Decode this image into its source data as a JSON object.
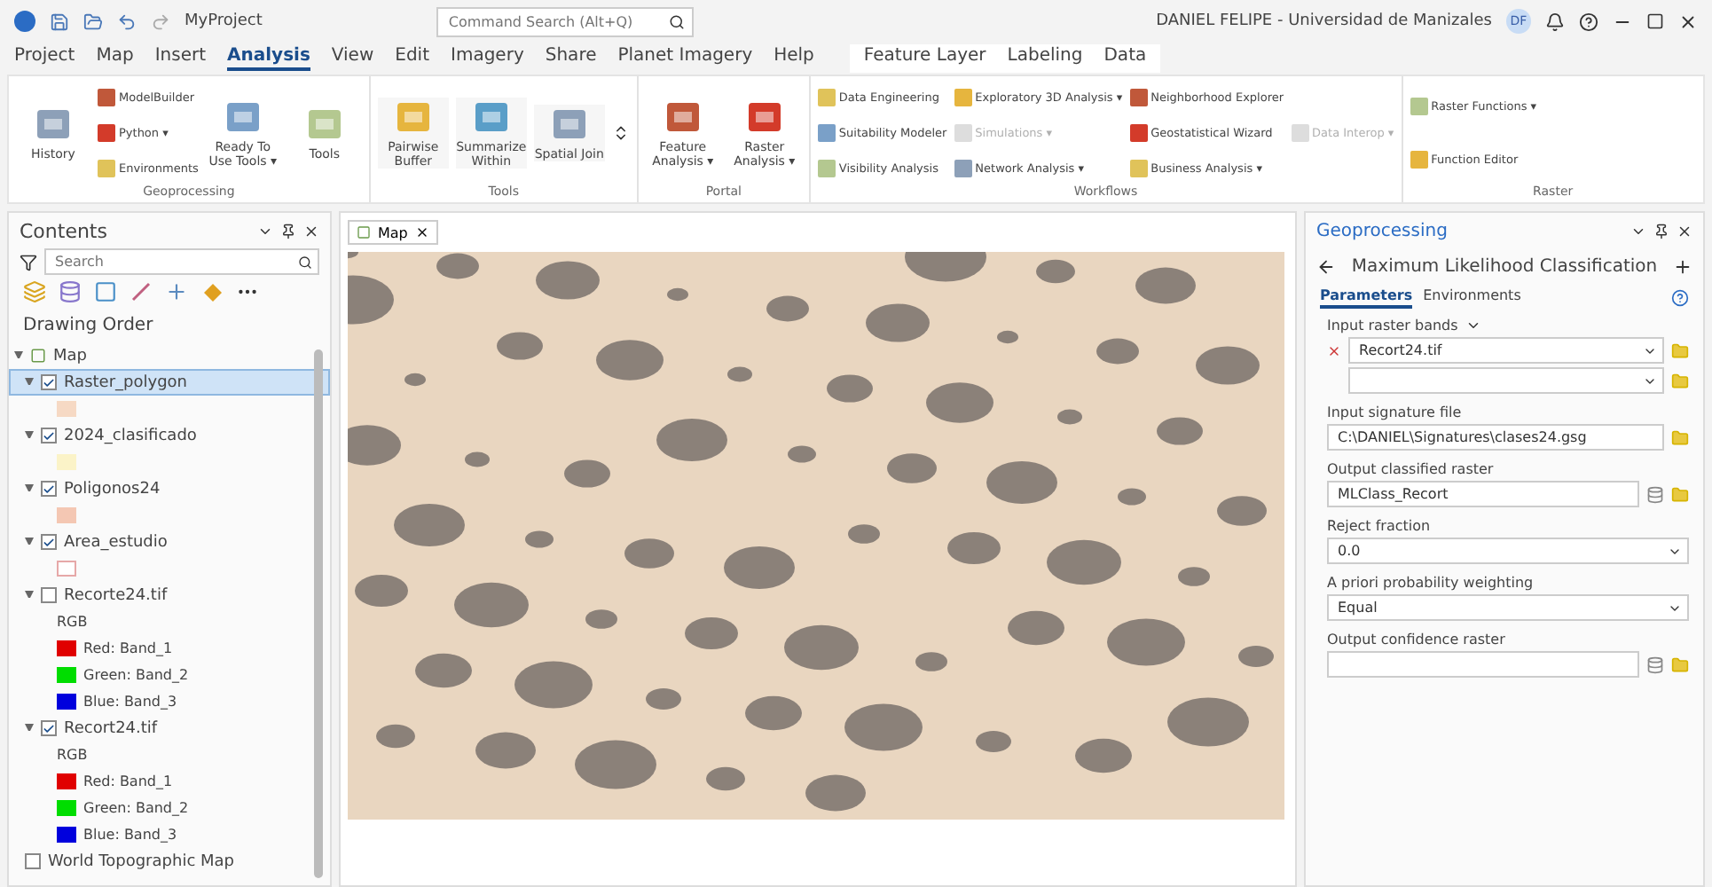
{
  "title_bar": {
    "project": "MyProject",
    "search_placeholder": "Command Search (Alt+Q)",
    "user": "DANIEL FELIPE - Universidad de Manizales",
    "initials": "DF"
  },
  "tabs": [
    {
      "label": "Project",
      "selected": false
    },
    {
      "label": "Map",
      "selected": false
    },
    {
      "label": "Insert",
      "selected": false
    },
    {
      "label": "Analysis",
      "selected": true
    },
    {
      "label": "View",
      "selected": false
    },
    {
      "label": "Edit",
      "selected": false
    },
    {
      "label": "Imagery",
      "selected": false
    },
    {
      "label": "Share",
      "selected": false
    },
    {
      "label": "Planet Imagery",
      "selected": false
    },
    {
      "label": "Help",
      "selected": false
    }
  ],
  "contextual_tabs": [
    {
      "label": "Feature Layer",
      "selected": false
    },
    {
      "label": "Labeling",
      "selected": false
    },
    {
      "label": "Data",
      "selected": false
    }
  ],
  "ribbon": [
    {
      "title": "Geoprocessing",
      "columns": [
        [
          {
            "label": "History",
            "kind": "large"
          }
        ],
        [
          {
            "label": "ModelBuilder",
            "kind": "small"
          },
          {
            "label": "Python ▾",
            "kind": "small"
          },
          {
            "label": "Environments",
            "kind": "small"
          }
        ],
        [
          {
            "label": "Ready To Use Tools ▾",
            "kind": "large"
          }
        ],
        [
          {
            "label": "Tools",
            "kind": "large"
          }
        ]
      ]
    },
    {
      "title": "Tools",
      "columns": [
        [
          {
            "label": "Pairwise Buffer",
            "kind": "gallery"
          }
        ],
        [
          {
            "label": "Summarize Within",
            "kind": "gallery"
          }
        ],
        [
          {
            "label": "Spatial Join",
            "kind": "gallery"
          }
        ]
      ]
    },
    {
      "title": "Portal",
      "columns": [
        [
          {
            "label": "Feature Analysis ▾",
            "kind": "large"
          }
        ],
        [
          {
            "label": "Raster Analysis ▾",
            "kind": "large"
          }
        ]
      ]
    },
    {
      "title": "Workflows",
      "columns": [
        [
          {
            "label": "Data Engineering",
            "kind": "small"
          },
          {
            "label": "Suitability Modeler",
            "kind": "small"
          },
          {
            "label": "Visibility Analysis",
            "kind": "small"
          }
        ],
        [
          {
            "label": "Exploratory 3D Analysis ▾",
            "kind": "small"
          },
          {
            "label": "Simulations ▾",
            "kind": "disabled"
          },
          {
            "label": "Network Analysis ▾",
            "kind": "small"
          }
        ],
        [
          {
            "label": "Neighborhood Explorer",
            "kind": "small"
          },
          {
            "label": "Geostatistical Wizard",
            "kind": "small"
          },
          {
            "label": "Business Analysis ▾",
            "kind": "small"
          }
        ],
        [
          {
            "label": "Data Interop ▾",
            "kind": "disabled"
          }
        ]
      ]
    },
    {
      "title": "Raster",
      "columns": [
        [
          {
            "label": "Raster Functions ▾",
            "kind": "small"
          },
          {
            "label": "Function Editor",
            "kind": "small"
          }
        ]
      ]
    }
  ],
  "contents": {
    "title": "Contents",
    "search_placeholder": "Search",
    "heading": "Drawing Order",
    "map": {
      "name": "Map",
      "expanded": true,
      "children": [
        {
          "name": "Raster_polygon",
          "checked": true,
          "selected": true,
          "kind": "polygon",
          "color": "#f6d9c4"
        },
        {
          "name": "2024_clasificado",
          "checked": true,
          "selected": false,
          "kind": "polygon",
          "color": "#fbf3c8"
        },
        {
          "name": "Poligonos24",
          "checked": true,
          "selected": false,
          "kind": "polygon",
          "color": "#f4c7b3"
        },
        {
          "name": "Area_estudio",
          "checked": true,
          "selected": false,
          "kind": "outline",
          "color": "#e6a8a8"
        },
        {
          "name": "Recorte24.tif",
          "checked": false,
          "selected": false,
          "kind": "rgb",
          "heading": "RGB",
          "bands": [
            {
              "label": "Red:  Band_1",
              "color": "#e00000"
            },
            {
              "label": "Green: Band_2",
              "color": "#00dd00"
            },
            {
              "label": "Blue:  Band_3",
              "color": "#0000dd"
            }
          ]
        },
        {
          "name": "Recort24.tif",
          "checked": true,
          "selected": false,
          "kind": "rgb",
          "heading": "RGB",
          "bands": [
            {
              "label": "Red:  Band_1",
              "color": "#e00000"
            },
            {
              "label": "Green: Band_2",
              "color": "#00dd00"
            },
            {
              "label": "Blue:  Band_3",
              "color": "#0000dd"
            }
          ]
        },
        {
          "name": "World Topographic Map",
          "checked": false,
          "selected": false,
          "kind": "basemap"
        }
      ]
    }
  },
  "map_tab": {
    "label": "Map"
  },
  "geoprocessing": {
    "title": "Geoprocessing",
    "tool": "Maximum Likelihood Classification",
    "tabs": [
      {
        "label": "Parameters",
        "selected": true
      },
      {
        "label": "Environments",
        "selected": false
      }
    ],
    "parameters": [
      {
        "label": "Input raster bands",
        "kind": "multi",
        "rows": [
          {
            "value": "Recort24.tif",
            "removable": true
          },
          {
            "removable": false
          }
        ]
      },
      {
        "label": "Input signature file",
        "kind": "file",
        "value": "C:\\DANIEL\\Signatures\\clases24.gsg"
      },
      {
        "label": "Output classified raster",
        "kind": "output",
        "value": "MLClass_Recort"
      },
      {
        "label": "Reject fraction",
        "kind": "select",
        "value": "0.0"
      },
      {
        "label": "A priori probability weighting",
        "kind": "select",
        "value": "Equal"
      },
      {
        "label": "Output confidence raster",
        "kind": "output"
      }
    ]
  }
}
